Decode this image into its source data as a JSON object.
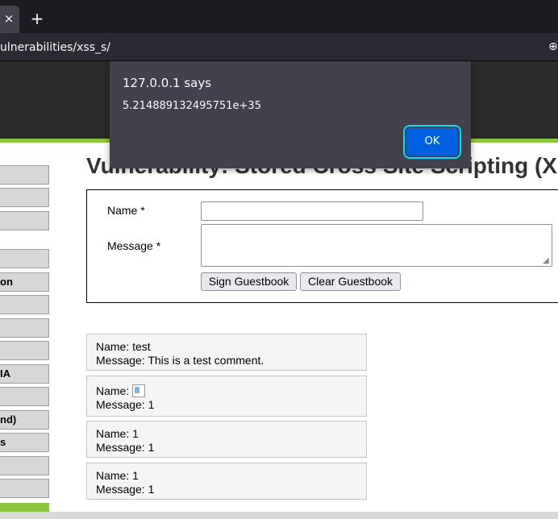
{
  "browser": {
    "tab_close": "×",
    "new_tab": "+",
    "url": "ulnerabilities/xss_s/",
    "url_icon": "⊕"
  },
  "menu": {
    "items": [
      {
        "label": ""
      },
      {
        "label": ""
      },
      {
        "label": ""
      },
      {
        "label": ""
      },
      {
        "label": "on"
      },
      {
        "label": ""
      },
      {
        "label": ""
      },
      {
        "label": ""
      },
      {
        "label": "IA"
      },
      {
        "label": ""
      },
      {
        "label": "nd)"
      },
      {
        "label": "s"
      },
      {
        "label": ""
      },
      {
        "label": ""
      }
    ]
  },
  "page": {
    "title": "Vulnerability: Stored Cross Site Scripting (X"
  },
  "form": {
    "name_label": "Name *",
    "message_label": "Message *",
    "name_value": "",
    "message_value": "",
    "sign_button": "Sign Guestbook",
    "clear_button": "Clear Guestbook"
  },
  "entries": [
    {
      "name_prefix": "Name: test",
      "message": "Message: This is a test comment."
    },
    {
      "name_prefix": "Name:",
      "message": "Message: 1"
    },
    {
      "name_prefix": "Name: 1",
      "message": "Message: 1"
    },
    {
      "name_prefix": "Name: 1",
      "message": "Message: 1"
    }
  ],
  "dialog": {
    "title": "127.0.0.1 says",
    "message": "5.214889132495751e+35",
    "ok": "OK"
  },
  "colors": {
    "accent_green": "#8cc63f",
    "header_dark": "#2a2a2a",
    "dialog_bg": "#42414d",
    "ok_blue": "#0061e0"
  }
}
